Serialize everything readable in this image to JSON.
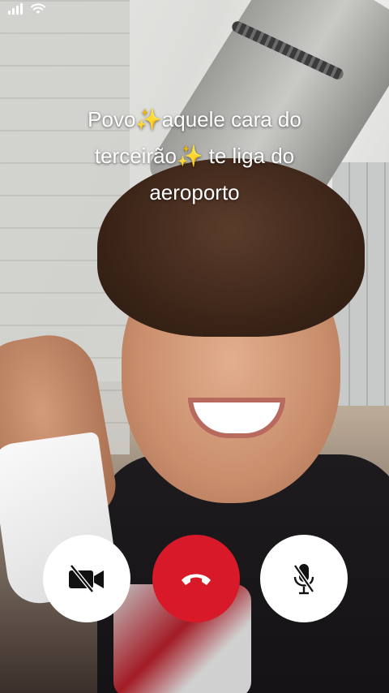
{
  "status_bar": {
    "signal_icon": "cellular-signal-icon",
    "wifi_icon": "wifi-icon"
  },
  "caption": {
    "line1": "Povo✨aquele cara do",
    "line2": "terceirão✨ te liga do",
    "line3": "aeroporto"
  },
  "call_controls": {
    "video_off_icon": "video-camera-off-icon",
    "hangup_icon": "phone-hangup-icon",
    "mute_icon": "microphone-off-icon",
    "hangup_color": "#d7192a"
  }
}
